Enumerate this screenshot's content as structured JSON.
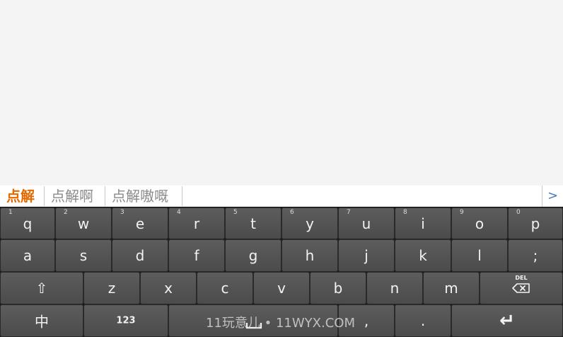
{
  "candidates": {
    "items": [
      "点解",
      "点解啊",
      "点解嗷嘅"
    ],
    "more_arrow": ">"
  },
  "keyboard": {
    "row1": [
      {
        "num": "1",
        "label": "q"
      },
      {
        "num": "2",
        "label": "w"
      },
      {
        "num": "3",
        "label": "e"
      },
      {
        "num": "4",
        "label": "r"
      },
      {
        "num": "5",
        "label": "t"
      },
      {
        "num": "6",
        "label": "y"
      },
      {
        "num": "7",
        "label": "u"
      },
      {
        "num": "8",
        "label": "i"
      },
      {
        "num": "9",
        "label": "o"
      },
      {
        "num": "0",
        "label": "p"
      }
    ],
    "row2": [
      "a",
      "s",
      "d",
      "f",
      "g",
      "h",
      "j",
      "k",
      "l",
      ";"
    ],
    "row3": [
      "z",
      "x",
      "c",
      "v",
      "b",
      "n",
      "m"
    ],
    "shift_symbol": "⇧",
    "del_label": "DEL",
    "lang_label": "中",
    "num_label": "123",
    "comma": ",",
    "period": ".",
    "enter_symbol": "↵"
  },
  "watermark": "11玩意儿 • 11WYX.COM",
  "colors": {
    "active_candidate": "#e46a00",
    "key_face": "#555555",
    "arrow": "#4a78c8"
  }
}
